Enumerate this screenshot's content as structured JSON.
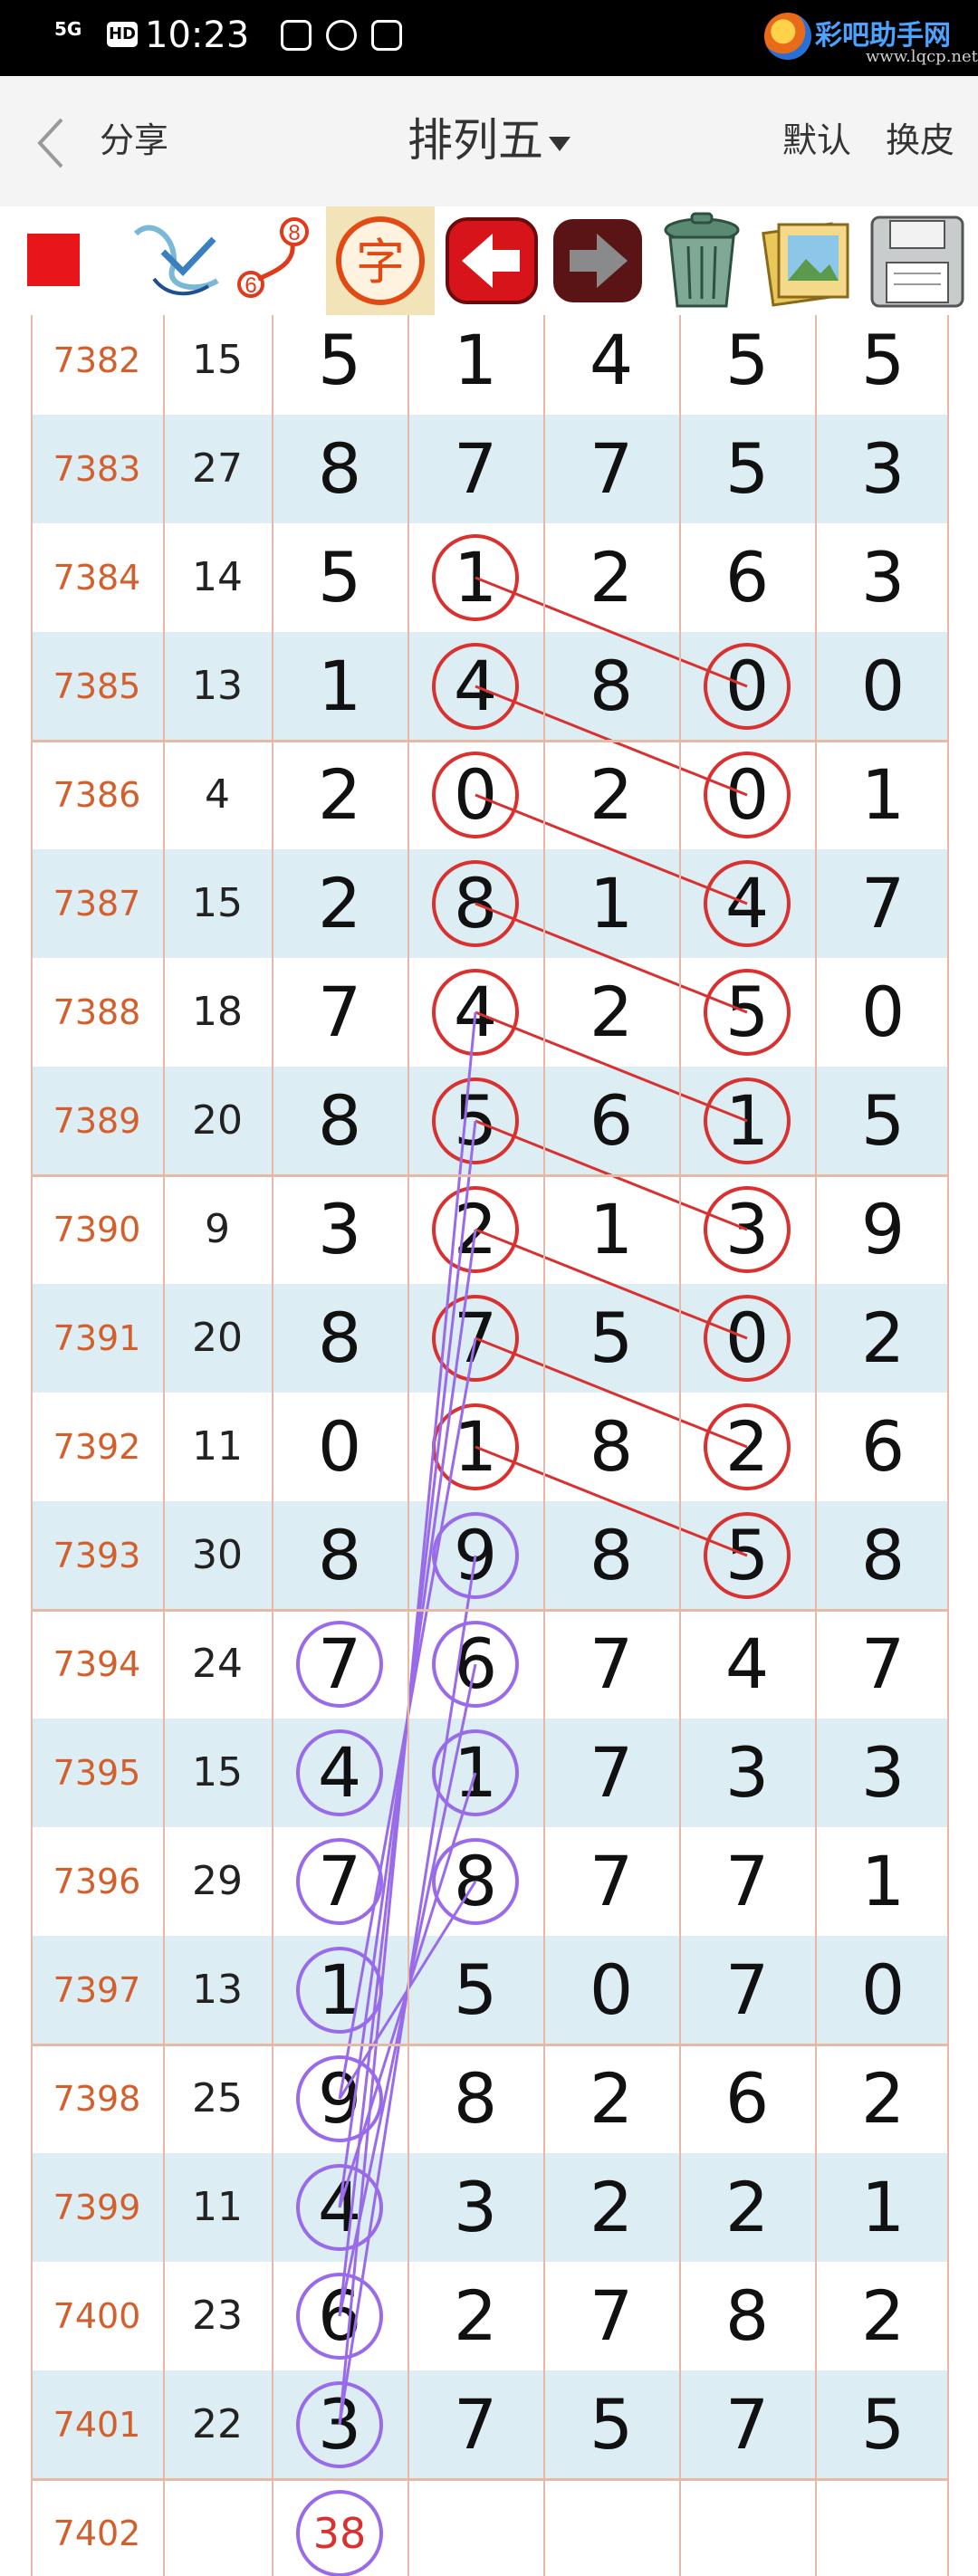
{
  "status_bar": {
    "signal": "5G",
    "hd": "HD",
    "time": "10:23",
    "logo_text": "彩吧助手网",
    "logo_url": "www.lqcp.net"
  },
  "nav": {
    "back_icon": "chevron-left-icon",
    "share": "分享",
    "title": "排列五",
    "default": "默认",
    "skin": "换皮"
  },
  "toolbar": {
    "items": [
      "red-square-icon",
      "pen-icon",
      "number-link-icon",
      "character-icon",
      "arrow-left-icon",
      "arrow-right-icon",
      "trash-icon",
      "photos-icon",
      "save-icon"
    ],
    "badge_small": "6",
    "badge_large": "8",
    "char_label": "字"
  },
  "colors": {
    "id_text": "#d2602e",
    "row_alt": "#dcedf3",
    "grid": "#e4b9a8",
    "red_circle": "#d93030",
    "purple_circle": "#9a6be8"
  },
  "table": {
    "rows": [
      {
        "id": "7382",
        "sum": "15",
        "digits": [
          "5",
          "1",
          "4",
          "5",
          "5"
        ]
      },
      {
        "id": "7383",
        "sum": "27",
        "digits": [
          "8",
          "7",
          "7",
          "5",
          "3"
        ]
      },
      {
        "id": "7384",
        "sum": "14",
        "digits": [
          "5",
          "1",
          "2",
          "6",
          "3"
        ]
      },
      {
        "id": "7385",
        "sum": "13",
        "digits": [
          "1",
          "4",
          "8",
          "0",
          "0"
        ]
      },
      {
        "id": "7386",
        "sum": "4",
        "digits": [
          "2",
          "0",
          "2",
          "0",
          "1"
        ]
      },
      {
        "id": "7387",
        "sum": "15",
        "digits": [
          "2",
          "8",
          "1",
          "4",
          "7"
        ]
      },
      {
        "id": "7388",
        "sum": "18",
        "digits": [
          "7",
          "4",
          "2",
          "5",
          "0"
        ]
      },
      {
        "id": "7389",
        "sum": "20",
        "digits": [
          "8",
          "5",
          "6",
          "1",
          "5"
        ]
      },
      {
        "id": "7390",
        "sum": "9",
        "digits": [
          "3",
          "2",
          "1",
          "3",
          "9"
        ]
      },
      {
        "id": "7391",
        "sum": "20",
        "digits": [
          "8",
          "7",
          "5",
          "0",
          "2"
        ]
      },
      {
        "id": "7392",
        "sum": "11",
        "digits": [
          "0",
          "1",
          "8",
          "2",
          "6"
        ]
      },
      {
        "id": "7393",
        "sum": "30",
        "digits": [
          "8",
          "9",
          "8",
          "5",
          "8"
        ]
      },
      {
        "id": "7394",
        "sum": "24",
        "digits": [
          "7",
          "6",
          "7",
          "4",
          "7"
        ]
      },
      {
        "id": "7395",
        "sum": "15",
        "digits": [
          "4",
          "1",
          "7",
          "3",
          "3"
        ]
      },
      {
        "id": "7396",
        "sum": "29",
        "digits": [
          "7",
          "8",
          "7",
          "7",
          "1"
        ]
      },
      {
        "id": "7397",
        "sum": "13",
        "digits": [
          "1",
          "5",
          "0",
          "7",
          "0"
        ]
      },
      {
        "id": "7398",
        "sum": "25",
        "digits": [
          "9",
          "8",
          "2",
          "6",
          "2"
        ]
      },
      {
        "id": "7399",
        "sum": "11",
        "digits": [
          "4",
          "3",
          "2",
          "2",
          "1"
        ]
      },
      {
        "id": "7400",
        "sum": "23",
        "digits": [
          "6",
          "2",
          "7",
          "8",
          "2"
        ]
      },
      {
        "id": "7401",
        "sum": "22",
        "digits": [
          "3",
          "7",
          "5",
          "7",
          "5"
        ]
      },
      {
        "id": "7402",
        "sum": "",
        "digits": [
          "38",
          "",
          "",
          "",
          ""
        ]
      }
    ]
  }
}
